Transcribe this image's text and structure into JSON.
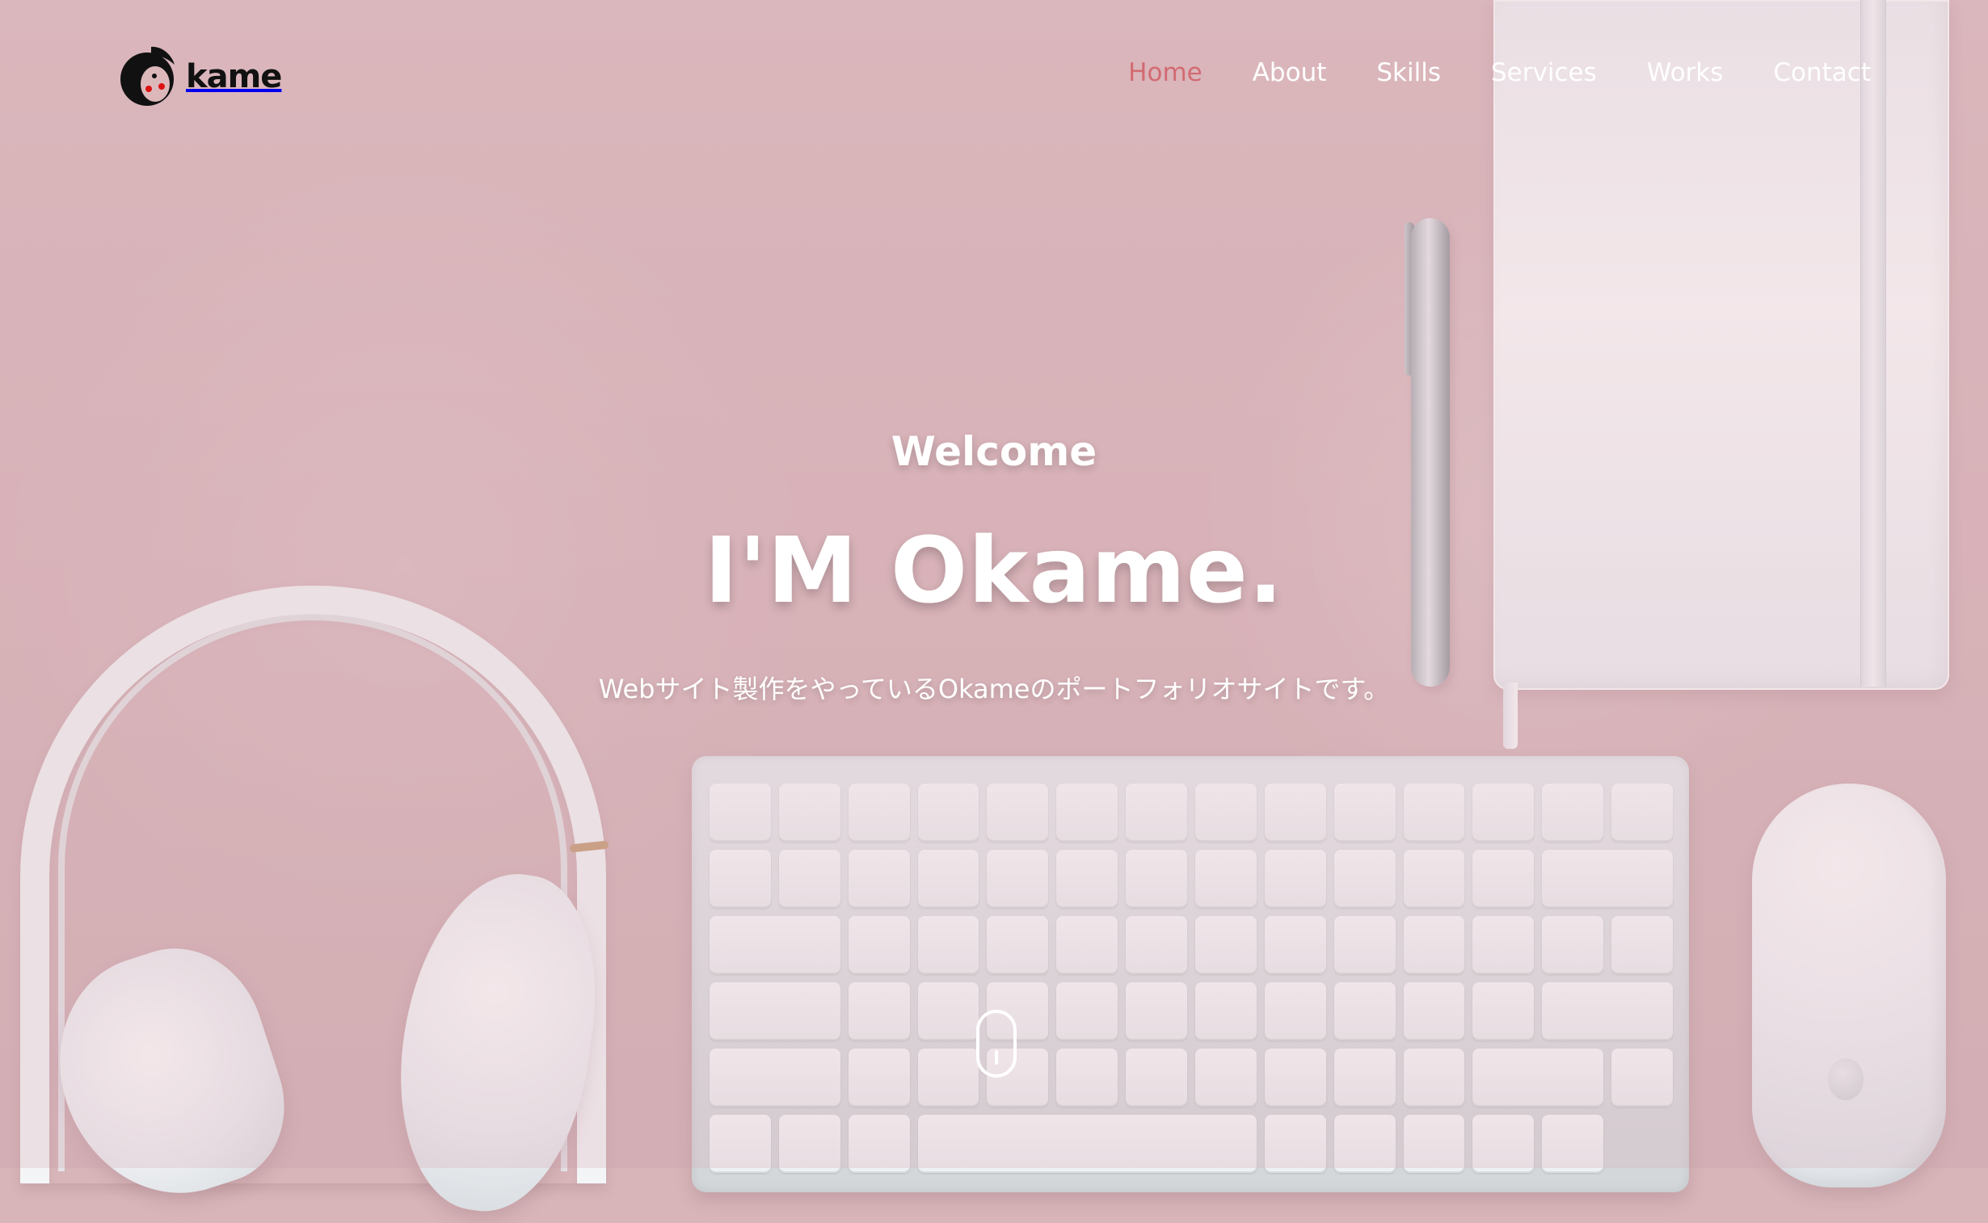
{
  "header": {
    "logo_text": "kame"
  },
  "nav": {
    "items": [
      {
        "label": "Home",
        "active": true
      },
      {
        "label": "About",
        "active": false
      },
      {
        "label": "Skills",
        "active": false
      },
      {
        "label": "Services",
        "active": false
      },
      {
        "label": "Works",
        "active": false
      },
      {
        "label": "Contact",
        "active": false
      }
    ]
  },
  "hero": {
    "welcome": "Welcome",
    "title": "I'M Okame.",
    "subtitle": "Webサイト製作をやっているOkameのポートフォリオサイトです。"
  },
  "icons": {
    "logo": "logo-icon",
    "scroll": "scroll-mouse-icon"
  },
  "colors": {
    "accent": "#d36a72",
    "hero_background": "#d7b5b9",
    "text_primary": "#ffffff"
  }
}
